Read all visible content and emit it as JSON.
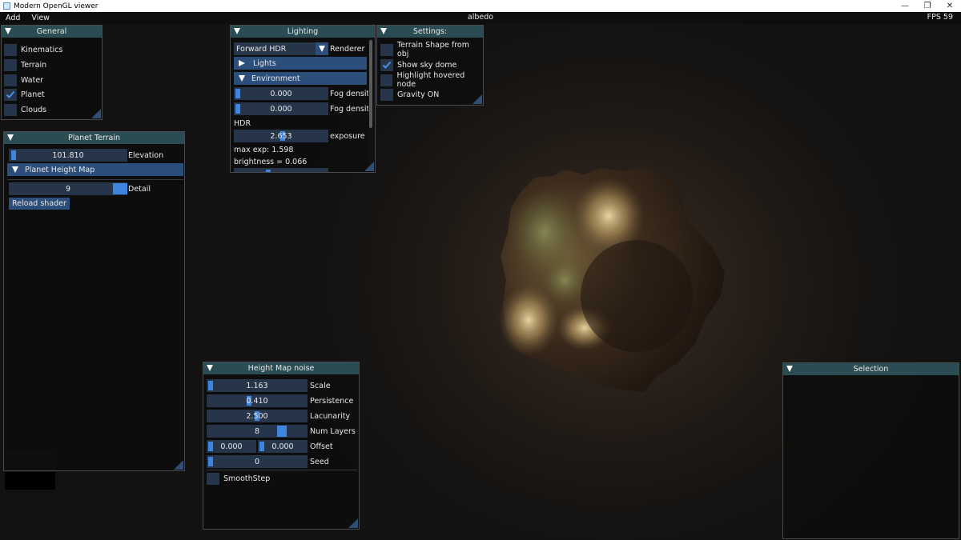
{
  "window": {
    "title": "Modern OpenGL viewer",
    "controls": {
      "minimize": "—",
      "restore": "❐",
      "close": "✕"
    }
  },
  "menubar": {
    "items": [
      "Add",
      "View"
    ],
    "center_text": "albedo",
    "fps": "FPS 59"
  },
  "general": {
    "title": "General",
    "items": [
      {
        "label": "Kinematics",
        "checked": false
      },
      {
        "label": "Terrain",
        "checked": false
      },
      {
        "label": "Water",
        "checked": false
      },
      {
        "label": "Planet",
        "checked": true
      },
      {
        "label": "Clouds",
        "checked": false
      }
    ]
  },
  "planet_terrain": {
    "title": "Planet Terrain",
    "elevation_value": "101.810",
    "elevation_label": "Elevation",
    "height_map_header": "Planet Height Map",
    "detail_value": "9",
    "detail_label": "Detail",
    "reload_button": "Reload shader"
  },
  "lighting": {
    "title": "Lighting",
    "renderer_value": "Forward HDR",
    "renderer_label": "Renderer",
    "lights_header": "Lights",
    "environment_header": "Environment",
    "fog1_value": "0.000",
    "fog1_label": "Fog density",
    "fog2_value": "0.000",
    "fog2_label": "Fog density",
    "hdr_label": "HDR",
    "exposure_value": "2.653",
    "exposure_label": "exposure",
    "max_exp": "max exp: 1.598",
    "brightness": "brightness = 0.066"
  },
  "settings": {
    "title": "Settings:",
    "items": [
      {
        "label": "Terrain Shape from obj",
        "checked": false
      },
      {
        "label": "Show sky dome",
        "checked": true
      },
      {
        "label": "Highlight hovered node",
        "checked": false
      },
      {
        "label": "Gravity ON",
        "checked": false
      }
    ]
  },
  "height_map_noise": {
    "title": "Height Map noise",
    "scale_value": "1.163",
    "scale_label": "Scale",
    "persistence_value": "0.410",
    "persistence_label": "Persistence",
    "lacunarity_value": "2.500",
    "lacunarity_label": "Lacunarity",
    "num_layers_value": "8",
    "num_layers_label": "Num Layers",
    "offset_x_value": "0.000",
    "offset_y_value": "0.000",
    "offset_label": "Offset",
    "seed_value": "0",
    "seed_label": "Seed",
    "smoothstep_label": "SmoothStep"
  },
  "selection": {
    "title": "Selection"
  },
  "colors": {
    "title_bar": "#2a4d53",
    "frame_bg": "#263549",
    "slider_grab": "#3d85e0",
    "header": "#2c4e7a",
    "check": "#4a90e2"
  }
}
